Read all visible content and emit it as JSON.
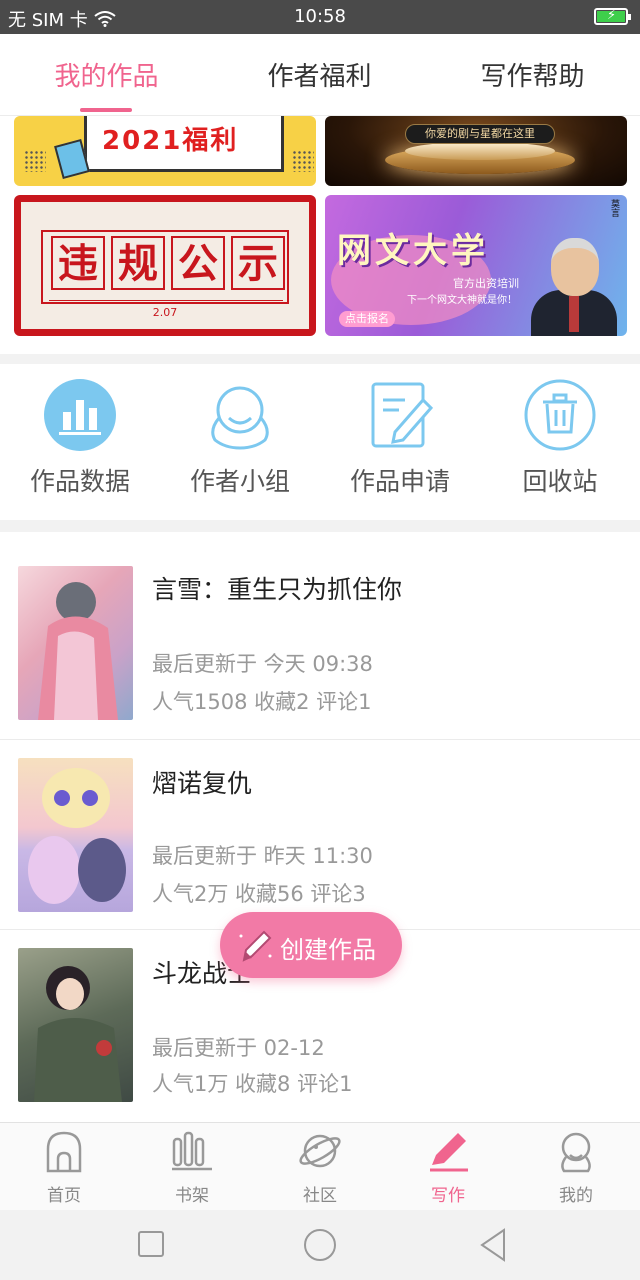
{
  "status_bar": {
    "carrier": "无 SIM 卡",
    "time": "10:58"
  },
  "top_tabs": [
    {
      "label": "我的作品",
      "active": true
    },
    {
      "label": "作者福利",
      "active": false
    },
    {
      "label": "写作帮助",
      "active": false
    }
  ],
  "banners": {
    "welfare": {
      "text": "2021福利"
    },
    "stage": {
      "text": "你爱的剧与星都在这里"
    },
    "notice": {
      "chars": [
        "违",
        "规",
        "公",
        "示"
      ],
      "date": "2.07"
    },
    "university": {
      "title": "网文大学",
      "sub1": "官方出资培训",
      "sub2": "下一个网文大神就是你！",
      "button": "点击报名",
      "vertical": "莫言"
    }
  },
  "quick_actions": [
    {
      "label": "作品数据",
      "icon": "bar-chart-icon"
    },
    {
      "label": "作者小组",
      "icon": "group-icon"
    },
    {
      "label": "作品申请",
      "icon": "edit-document-icon"
    },
    {
      "label": "回收站",
      "icon": "trash-icon"
    }
  ],
  "works": [
    {
      "title": "言雪：重生只为抓住你",
      "updated": "最后更新于 今天 09:38",
      "stats": "人气1508 收藏2 评论1"
    },
    {
      "title": "熠诺复仇",
      "updated": "最后更新于 昨天 11:30",
      "stats": "人气2万 收藏56 评论3"
    },
    {
      "title": "斗龙战士",
      "updated": "最后更新于 02-12",
      "stats": "人气1万 收藏8 评论1"
    }
  ],
  "fab": {
    "label": "创建作品"
  },
  "bottom_nav": [
    {
      "label": "首页",
      "icon": "home-icon",
      "active": false
    },
    {
      "label": "书架",
      "icon": "bookshelf-icon",
      "active": false
    },
    {
      "label": "社区",
      "icon": "planet-icon",
      "active": false
    },
    {
      "label": "写作",
      "icon": "pen-icon",
      "active": true
    },
    {
      "label": "我的",
      "icon": "profile-icon",
      "active": false
    }
  ],
  "colors": {
    "accent": "#f0648e",
    "icon_blue": "#7cc8ef",
    "fab": "#f27aa6"
  }
}
